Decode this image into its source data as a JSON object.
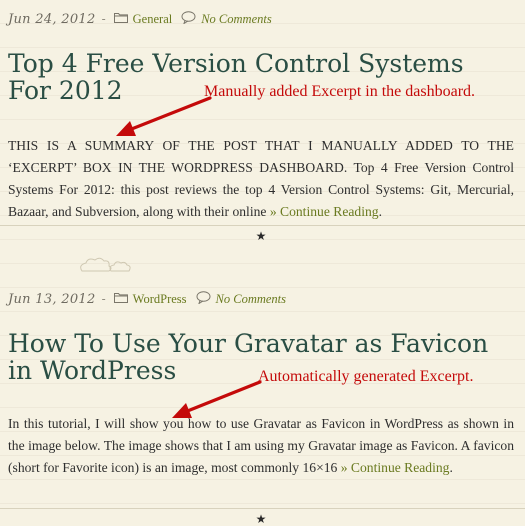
{
  "posts": [
    {
      "date": "Jun 24, 2012",
      "dash": "-",
      "category": "General",
      "comments": "No Comments",
      "title": "Top 4 Free Version Control Systems For 2012",
      "excerpt": "THIS IS A SUMMARY OF THE POST THAT I MANUALLY ADDED TO THE ‘EXCERPT’ BOX IN THE WORDPRESS DASHBOARD. Top 4 Free Version Control Systems For 2012: this post reviews the top 4 Version Control Systems: Git, Mercurial, Bazaar, and Subversion, along with their online ",
      "more": "» Continue Reading",
      "after_more": ".",
      "annotation": "Manually added Excerpt in the dashboard."
    },
    {
      "date": "Jun 13, 2012",
      "dash": "-",
      "category": "WordPress",
      "comments": "No Comments",
      "title": "How To Use Your Gravatar as Favicon in WordPress",
      "excerpt": "In this tutorial, I will show you how to use Gravatar as Favicon in WordPress as shown in the image below. The image shows that I am using my Gravatar image as Favicon. A favicon (short for Favorite icon) is an image, most commonly 16×16 ",
      "more": "» Continue Reading",
      "after_more": ".",
      "annotation": "Automatically generated Excerpt."
    }
  ],
  "separator_glyph": "★",
  "colors": {
    "title": "#2a4e44",
    "link": "#6a7a20",
    "annotation": "#c40a0a",
    "arrow": "#c40a0a"
  },
  "icons": [
    "folder-icon",
    "comment-bubble-icon",
    "cloud-divider-icon",
    "red-arrow",
    "star-separator-icon"
  ]
}
